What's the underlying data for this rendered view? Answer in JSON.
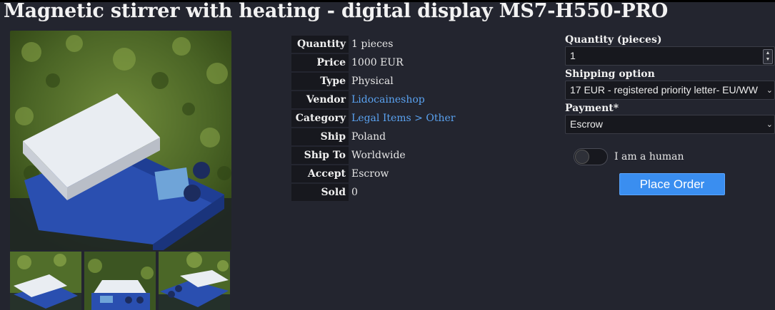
{
  "product": {
    "title": "Magnetic stirrer with heating - digital display MS7-H550-PRO"
  },
  "specs": [
    {
      "label": "Quantity",
      "value": "1 pieces",
      "link": false
    },
    {
      "label": "Price",
      "value": "1000 EUR",
      "link": false
    },
    {
      "label": "Type",
      "value": "Physical",
      "link": false
    },
    {
      "label": "Vendor",
      "value": "Lidocaineshop",
      "link": true
    },
    {
      "label": "Category",
      "value": "Legal Items > Other",
      "link": true
    },
    {
      "label": "Ship From",
      "value": "Poland",
      "link": false
    },
    {
      "label": "Ship To",
      "value": "Worldwide",
      "link": false
    },
    {
      "label": "Accept",
      "value": "Escrow",
      "link": false
    },
    {
      "label": "Sold",
      "value": "0",
      "link": false
    }
  ],
  "order_form": {
    "quantity_label": "Quantity (pieces)",
    "quantity_value": "1",
    "shipping_label": "Shipping option",
    "shipping_value": "17 EUR - registered priority letter- EU/WW",
    "payment_label": "Payment*",
    "payment_value": "Escrow",
    "human_label": "I am a human",
    "place_order_label": "Place Order"
  },
  "icons": {
    "stepper_up": "chevron-up-icon",
    "stepper_down": "chevron-down-icon",
    "select_arrow": "chevron-down-icon"
  },
  "colors": {
    "background": "#23252f",
    "link": "#5aa2f0",
    "button": "#3a8ef0",
    "label_cell": "#17181e"
  }
}
